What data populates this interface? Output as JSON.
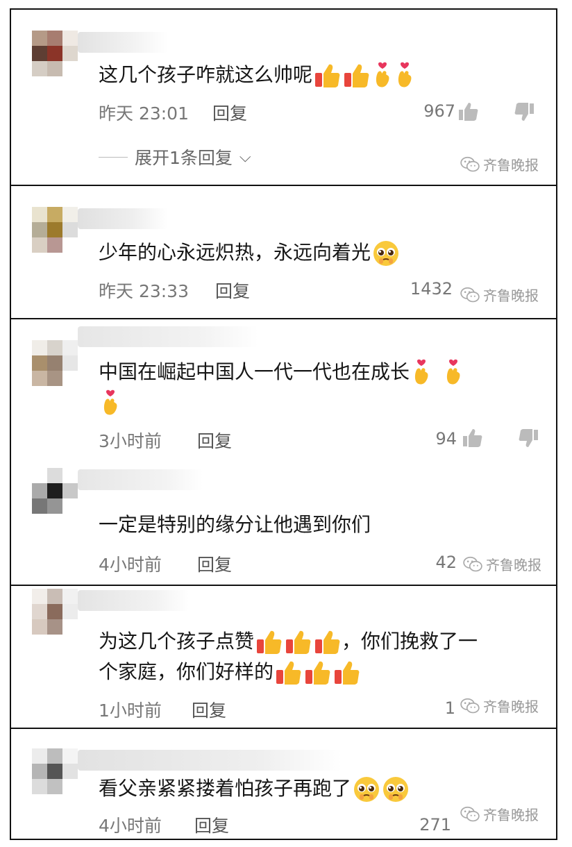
{
  "watermark": "齐鲁晚报",
  "reply_label": "回复",
  "comments": [
    {
      "text": "这几个孩子咋就这么帅呢",
      "time": "昨天 23:01",
      "likes": "967",
      "expand": "展开1条回复"
    },
    {
      "text": "少年的心永远炽热，永远向着光",
      "time": "昨天 23:33",
      "likes": "1432"
    },
    {
      "text": "中国在崛起中国人一代一代也在成长",
      "time": "3小时前",
      "likes": "94"
    },
    {
      "text": "一定是特别的缘分让他遇到你们",
      "time": "4小时前",
      "likes": "42"
    },
    {
      "text_line1": "为这几个孩子点赞",
      "text_line1b": "，你们挽救了一",
      "text_line2": "个家庭，你们好样的",
      "time": "1小时前",
      "likes": "1"
    },
    {
      "text": "看父亲紧紧搂着怕孩子再跑了",
      "time": "4小时前",
      "likes": "271"
    }
  ]
}
